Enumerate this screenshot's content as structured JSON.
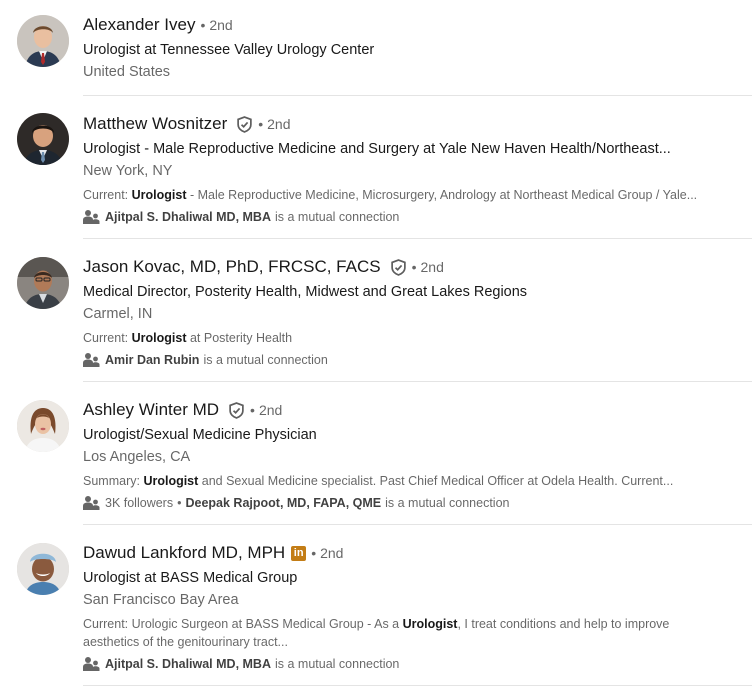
{
  "results": [
    {
      "name": "Alexander Ivey",
      "degree_dot": "•",
      "degree": "2nd",
      "headline": "Urologist at Tennessee Valley Urology Center",
      "location": "United States"
    },
    {
      "name": "Matthew Wosnitzer",
      "degree_dot": "•",
      "degree": "2nd",
      "headline": "Urologist - Male Reproductive Medicine and Surgery at Yale New Haven Health/Northeast...",
      "location": "New York, NY",
      "summary_prefix": "Current: ",
      "summary_bold": "Urologist",
      "summary_rest": " - Male Reproductive Medicine, Microsurgery, Andrology at Northeast Medical Group / Yale...",
      "mutual_name": "Ajitpal S. Dhaliwal MD, MBA",
      "mutual_suffix": "is a mutual connection"
    },
    {
      "name": "Jason Kovac, MD, PhD, FRCSC, FACS",
      "degree_dot": "•",
      "degree": "2nd",
      "headline": "Medical Director, Posterity Health, Midwest and Great Lakes Regions",
      "location": "Carmel, IN",
      "summary_prefix": "Current: ",
      "summary_bold": "Urologist",
      "summary_rest": " at Posterity Health",
      "mutual_name": "Amir Dan Rubin",
      "mutual_suffix": "is a mutual connection"
    },
    {
      "name": "Ashley Winter MD",
      "degree_dot": "•",
      "degree": "2nd",
      "headline": "Urologist/Sexual Medicine Physician",
      "location": "Los Angeles, CA",
      "summary_prefix": "Summary: ",
      "summary_bold": "Urologist",
      "summary_rest": " and Sexual Medicine specialist. Past Chief Medical Officer at Odela Health. Current...",
      "followers": "3K followers",
      "followers_sep": "•",
      "mutual_name": "Deepak Rajpoot, MD, FAPA, QME",
      "mutual_suffix": "is a mutual connection"
    },
    {
      "name": "Dawud Lankford MD, MPH",
      "badge_text": "in",
      "degree_dot": "•",
      "degree": "2nd",
      "headline": "Urologist at BASS Medical Group",
      "location": "San Francisco Bay Area",
      "summary_prefix": "Current: Urologic Surgeon at BASS Medical Group - As a ",
      "summary_bold": "Urologist",
      "summary_rest": ", I treat conditions and help to improve aesthetics of the genitourinary tract...",
      "mutual_name": "Ajitpal S. Dhaliwal MD, MBA",
      "mutual_suffix": "is a mutual connection"
    }
  ],
  "colors": {
    "verified": "#5e5e5e",
    "premium_badge": "#c37d16",
    "divider": "#e4e4e4"
  }
}
